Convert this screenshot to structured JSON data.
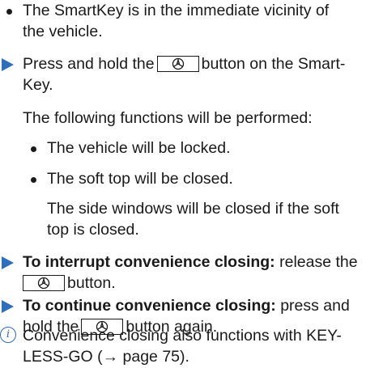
{
  "items": {
    "b1_l1": "The SmartKey is in the immediate vicinity of",
    "b1_l2": "the vehicle.",
    "s1_l1a": "Press and hold the",
    "s1_l1b": "button on the Smart-",
    "s1_l2": "Key.",
    "p1": "The following functions will be performed:",
    "sb1": "The vehicle will be locked.",
    "sb2": "The soft top will be closed.",
    "sb2n_l1": "The side windows will be closed if the soft",
    "sb2n_l2": "top is closed.",
    "s2_bold": "To interrupt convenience closing:",
    "s2_l1": "release the",
    "s2_l2": "button.",
    "s3_bold": "To continue convenience closing:",
    "s3_l1": "press and",
    "s3_l2a": "hold the",
    "s3_l2b": "button again.",
    "info_l1": "Convenience closing also functions with KEY-",
    "info_l2": "LESS-GO (→ page 75)."
  },
  "icons": {
    "action_step": "triangle-arrow-icon",
    "info": "info-icon",
    "key_button": "lock-button-icon"
  },
  "colors": {
    "accent": "#2d6ebd",
    "text": "#1a1a1a"
  }
}
